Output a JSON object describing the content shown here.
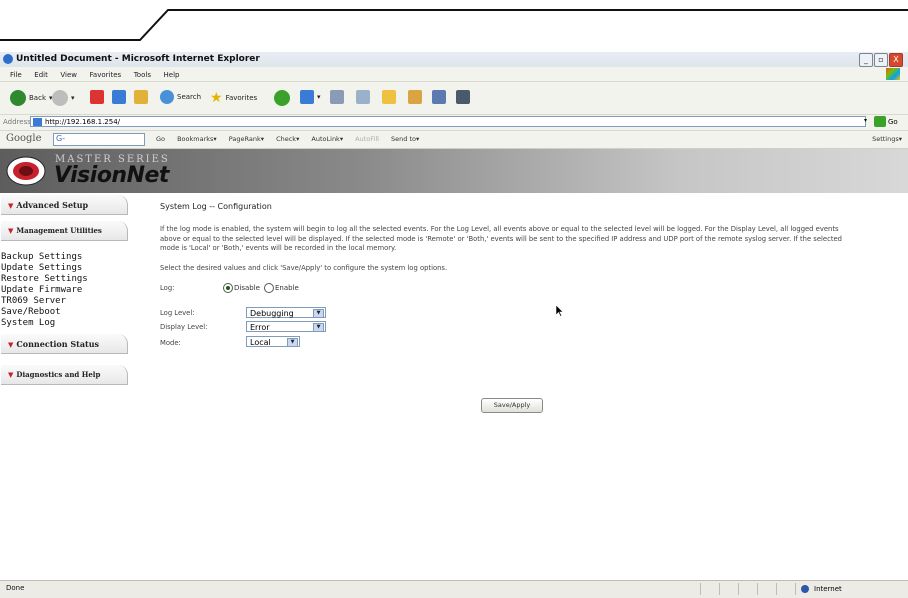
{
  "window": {
    "title": "Untitled Document - Microsoft Internet Explorer",
    "controls": [
      "_",
      "▫",
      "X"
    ]
  },
  "menubar": [
    "File",
    "Edit",
    "View",
    "Favorites",
    "Tools",
    "Help"
  ],
  "toolbar": {
    "back": "Back",
    "search": "Search",
    "favorites": "Favorites"
  },
  "address": {
    "label": "Address",
    "url": "http://192.168.1.254/",
    "go": "Go"
  },
  "googlebar": {
    "logo": "Google",
    "search_prefix": "G-",
    "items": [
      "Go",
      "Bookmarks▾",
      "PageRank▾",
      "Check▾",
      "AutoLink▾",
      "AutoFill",
      "Send to▾"
    ],
    "settings": "Settings▾"
  },
  "banner": {
    "series": "MASTER SERIES",
    "brand": "VisionNet"
  },
  "sidebar": {
    "advanced_setup": "Advanced Setup",
    "management_utilities": "Management Utilities",
    "links": [
      "Backup Settings",
      "Update Settings",
      "Restore Settings",
      "Update Firmware",
      "TR069 Server",
      "Save/Reboot",
      "System Log"
    ],
    "connection_status": "Connection Status",
    "diagnostics": "Diagnostics and Help"
  },
  "main": {
    "title": "System Log -- Configuration",
    "description": "If the log mode is enabled, the system will begin to log all the selected events. For the Log Level, all events above or equal to the selected level will be logged. For the Display Level, all logged events above or equal to the selected level will be displayed. If the selected mode is 'Remote' or 'Both,' events will be sent to the specified IP address and UDP port of the remote syslog server. If the selected mode is 'Local' or 'Both,' events will be recorded in the local memory.",
    "instruction": "Select the desired values and click 'Save/Apply' to configure the system log options.",
    "log_label": "Log:",
    "log_options": [
      "Disable",
      "Enable"
    ],
    "log_selected": "Disable",
    "log_level_label": "Log Level:",
    "log_level_value": "Debugging",
    "display_level_label": "Display Level:",
    "display_level_value": "Error",
    "mode_label": "Mode:",
    "mode_value": "Local",
    "apply_button": "Save/Apply"
  },
  "status": {
    "left": "Done",
    "zone": "Internet"
  }
}
